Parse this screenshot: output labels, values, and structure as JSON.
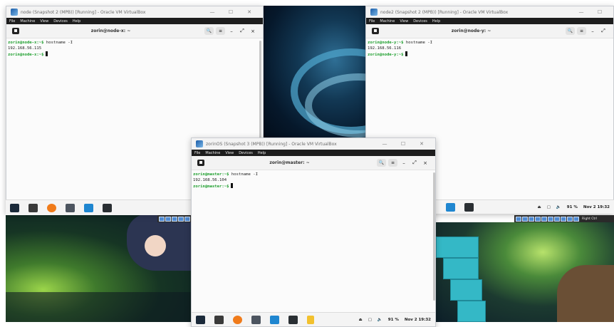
{
  "colors": {
    "prompt_green": "#1e9f2e",
    "terminal_bg": "#fbfbfb",
    "menu_bg": "#1d1d1d"
  },
  "window_controls": {
    "minimize": "—",
    "maximize": "☐",
    "close": "✕"
  },
  "vbox_menu": [
    "File",
    "Machine",
    "View",
    "Devices",
    "Help"
  ],
  "terminal_buttons": {
    "search": "🔍",
    "menu": "≡",
    "minimize": "–",
    "fullscreen": "⤢",
    "close": "×"
  },
  "vm_node_x": {
    "title": "node (Snapshot 2 (MPB)) [Running] - Oracle VM VirtualBox",
    "terminal_title": "zorin@node-x: ~",
    "lines": [
      {
        "prompt": "zorin@node-x:~$",
        "cmd": " hostname -I"
      },
      {
        "output": "192.168.56.115"
      },
      {
        "prompt": "zorin@node-x:~$",
        "cmd": ""
      }
    ]
  },
  "vm_node_y": {
    "title": "node2 (Snapshot 2 (MPB)) [Running] - Oracle VM VirtualBox",
    "terminal_title": "zorin@node-y: ~",
    "lines": [
      {
        "prompt": "zorin@node-y:~$",
        "cmd": " hostname -I"
      },
      {
        "output": "192.168.56.116"
      },
      {
        "prompt": "zorin@node-y:~$",
        "cmd": ""
      }
    ],
    "tray": {
      "battery": "91 %",
      "datetime": "Nov 2 19:32"
    },
    "host_key": "Right Ctrl"
  },
  "vm_master": {
    "title": "zorinOS (Snapshot 3 (MPB)) [Running] - Oracle VM VirtualBox",
    "terminal_title": "zorin@master: ~",
    "lines": [
      {
        "prompt": "zorin@master:~$",
        "cmd": " hostname -I"
      },
      {
        "output": "192.168.56.104"
      },
      {
        "prompt": "zorin@master:~$",
        "cmd": ""
      }
    ],
    "tray": {
      "battery": "91 %",
      "datetime": "Nov 2 19:32"
    }
  }
}
